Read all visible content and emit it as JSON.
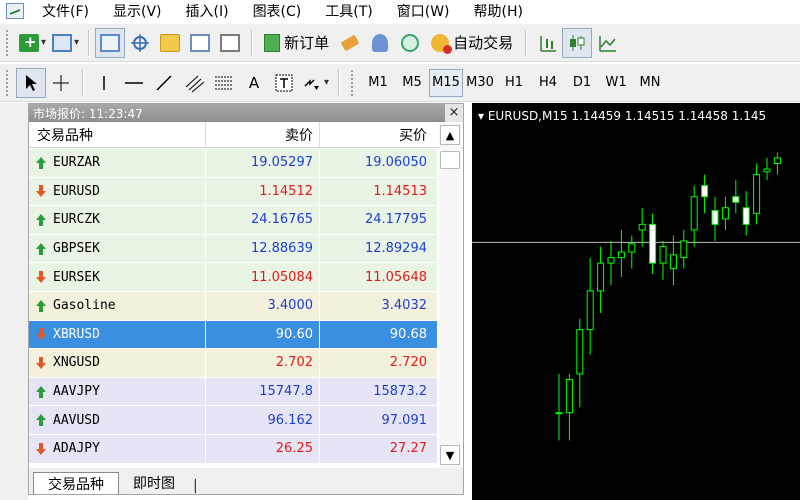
{
  "menu": {
    "items": [
      {
        "label": "文件(F)"
      },
      {
        "label": "显示(V)"
      },
      {
        "label": "插入(I)"
      },
      {
        "label": "图表(C)"
      },
      {
        "label": "工具(T)"
      },
      {
        "label": "窗口(W)"
      },
      {
        "label": "帮助(H)"
      }
    ]
  },
  "toolbar": {
    "new_order_label": "新订单",
    "auto_trading_label": "自动交易",
    "timeframes": [
      "M1",
      "M5",
      "M15",
      "M30",
      "H1",
      "H4",
      "D1",
      "W1",
      "MN"
    ],
    "active_timeframe": "M15",
    "text_tool_label": "A"
  },
  "market_watch": {
    "title": "市场报价: 11:23:47",
    "close_label": "×",
    "columns": {
      "symbol": "交易品种",
      "bid": "卖价",
      "ask": "买价"
    },
    "rows": [
      {
        "symbol": "EURZAR",
        "bid": "19.05297",
        "ask": "19.06050",
        "direction": "up"
      },
      {
        "symbol": "EURUSD",
        "bid": "1.14512",
        "ask": "1.14513",
        "direction": "down"
      },
      {
        "symbol": "EURCZK",
        "bid": "24.16765",
        "ask": "24.17795",
        "direction": "up"
      },
      {
        "symbol": "GBPSEK",
        "bid": "12.88639",
        "ask": "12.89294",
        "direction": "up"
      },
      {
        "symbol": "EURSEK",
        "bid": "11.05084",
        "ask": "11.05648",
        "direction": "down"
      },
      {
        "symbol": "Gasoline",
        "bid": "3.4000",
        "ask": "3.4032",
        "direction": "up"
      },
      {
        "symbol": "XBRUSD",
        "bid": "90.60",
        "ask": "90.68",
        "direction": "down",
        "selected": true
      },
      {
        "symbol": "XNGUSD",
        "bid": "2.702",
        "ask": "2.720",
        "direction": "down"
      },
      {
        "symbol": "AAVJPY",
        "bid": "15747.8",
        "ask": "15873.2",
        "direction": "up"
      },
      {
        "symbol": "AAVUSD",
        "bid": "96.162",
        "ask": "97.091",
        "direction": "up"
      },
      {
        "symbol": "ADAJPY",
        "bid": "26.25",
        "ask": "27.27",
        "direction": "down"
      }
    ],
    "tabs": [
      {
        "label": "交易品种",
        "active": true
      },
      {
        "label": "即时图",
        "active": false
      }
    ],
    "tab_separator": "|"
  },
  "chart": {
    "title": "▾ EURUSD,M15  1.14459 1.14515 1.14458 1.145",
    "candle_color": "#00ff00",
    "background": "#000000",
    "grid_line_color": "#c0c0c0",
    "candles": [
      {
        "o": 1.1384,
        "h": 1.1398,
        "l": 1.1374,
        "c": 1.1384,
        "bull": false
      },
      {
        "o": 1.1384,
        "h": 1.1398,
        "l": 1.1374,
        "c": 1.1396,
        "bull": true
      },
      {
        "o": 1.1398,
        "h": 1.1418,
        "l": 1.1386,
        "c": 1.1414,
        "bull": true
      },
      {
        "o": 1.1414,
        "h": 1.144,
        "l": 1.1405,
        "c": 1.1428,
        "bull": true
      },
      {
        "o": 1.1428,
        "h": 1.1444,
        "l": 1.142,
        "c": 1.1438,
        "bull": true
      },
      {
        "o": 1.1438,
        "h": 1.1446,
        "l": 1.143,
        "c": 1.144,
        "bull": true
      },
      {
        "o": 1.144,
        "h": 1.145,
        "l": 1.1433,
        "c": 1.1442,
        "bull": true
      },
      {
        "o": 1.1442,
        "h": 1.1448,
        "l": 1.1436,
        "c": 1.1445,
        "bull": true
      },
      {
        "o": 1.145,
        "h": 1.1458,
        "l": 1.1444,
        "c": 1.1452,
        "bull": true
      },
      {
        "o": 1.1452,
        "h": 1.1456,
        "l": 1.1434,
        "c": 1.1438,
        "bull": false
      },
      {
        "o": 1.1438,
        "h": 1.1446,
        "l": 1.1432,
        "c": 1.1444,
        "bull": true
      },
      {
        "o": 1.1441,
        "h": 1.1448,
        "l": 1.143,
        "c": 1.1436,
        "bull": true
      },
      {
        "o": 1.144,
        "h": 1.145,
        "l": 1.1436,
        "c": 1.1446,
        "bull": true
      },
      {
        "o": 1.145,
        "h": 1.1466,
        "l": 1.1444,
        "c": 1.1462,
        "bull": true
      },
      {
        "o": 1.1462,
        "h": 1.147,
        "l": 1.1456,
        "c": 1.1466,
        "bull": false
      },
      {
        "o": 1.1452,
        "h": 1.1462,
        "l": 1.1446,
        "c": 1.1457,
        "bull": false
      },
      {
        "o": 1.1454,
        "h": 1.1462,
        "l": 1.145,
        "c": 1.1458,
        "bull": true
      },
      {
        "o": 1.146,
        "h": 1.1468,
        "l": 1.1456,
        "c": 1.1462,
        "bull": false
      },
      {
        "o": 1.1458,
        "h": 1.1464,
        "l": 1.1448,
        "c": 1.1452,
        "bull": false
      },
      {
        "o": 1.1456,
        "h": 1.1474,
        "l": 1.1452,
        "c": 1.147,
        "bull": true
      },
      {
        "o": 1.1471,
        "h": 1.1476,
        "l": 1.1468,
        "c": 1.1472,
        "bull": true
      },
      {
        "o": 1.1474,
        "h": 1.1478,
        "l": 1.147,
        "c": 1.1476,
        "bull": true
      }
    ],
    "price_range": [
      1.1355,
      1.1485
    ],
    "horizontal_line_price": 1.14455
  }
}
